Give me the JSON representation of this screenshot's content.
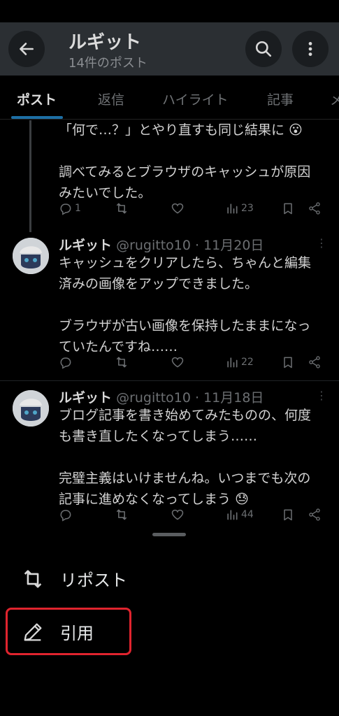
{
  "header": {
    "profile_name": "ルギット",
    "post_count": "14件のポスト"
  },
  "tabs": [
    {
      "label": "ポスト"
    },
    {
      "label": "返信"
    },
    {
      "label": "ハイライト"
    },
    {
      "label": "記事"
    },
    {
      "label": "メ"
    }
  ],
  "feed": {
    "tweet1": {
      "text": "「何で…？」とやり直すも同じ結果に 😮\n\n調べてみるとブラウザのキャッシュが原因\nみたいでした。",
      "replies": "1",
      "views": "23"
    },
    "tweet2": {
      "name": "ルギット",
      "handle": "@rugitto10 · 11月20日",
      "text": "キャッシュをクリアしたら、ちゃんと編集\n済みの画像をアップできました。\n\nブラウザが古い画像を保持したままになっ\nていたんですね……",
      "views": "22"
    },
    "tweet3": {
      "name": "ルギット",
      "handle": "@rugitto10 · 11月18日",
      "text": "ブログ記事を書き始めてみたものの、何度\nも書き直したくなってしまう……\n\n完璧主義はいけませんね。いつまでも次の\n記事に進めなくなってしまう 😓",
      "views": "44"
    }
  },
  "sheet": {
    "repost_label": "リポスト",
    "quote_label": "引用"
  },
  "colors": {
    "accent_underline": "#1d6fa5",
    "highlight_box": "#e0242e"
  }
}
